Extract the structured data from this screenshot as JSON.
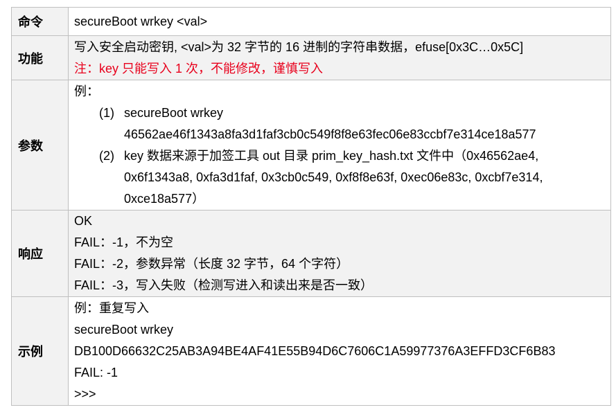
{
  "rows": {
    "command": {
      "label": "命令",
      "text": "secureBoot wrkey <val>"
    },
    "function": {
      "label": "功能",
      "line1": "写入安全启动密钥, <val>为 32 字节的 16 进制的字符串数据，efuse[0x3C…0x5C]",
      "line2": "注：key 只能写入 1 次，不能修改，谨慎写入"
    },
    "params": {
      "label": "参数",
      "intro": "例：",
      "item1_num": "(1)",
      "item1_cmd": "secureBoot wrkey",
      "item1_val": "46562ae46f1343a8fa3d1faf3cb0c549f8f8e63fec06e83ccbf7e314ce18a577",
      "item2_num": "(2)",
      "item2_line1": "key 数据来源于加签工具 out 目录 prim_key_hash.txt 文件中（0x46562ae4,",
      "item2_line2": "0x6f1343a8, 0xfa3d1faf, 0x3cb0c549, 0xf8f8e63f, 0xec06e83c, 0xcbf7e314,",
      "item2_line3": "0xce18a577）"
    },
    "response": {
      "label": "响应",
      "line1": "OK",
      "line2": "FAIL：-1，不为空",
      "line3": "FAIL：-2，参数异常（长度 32 字节，64 个字符）",
      "line4": "FAIL：-3，写入失败（检测写进入和读出来是否一致）"
    },
    "example": {
      "label": "示例",
      "line1": "例：重复写入",
      "line2": "secureBoot wrkey",
      "line3": "DB100D66632C25AB3A94BE4AF41E55B94D6C7606C1A59977376A3EFFD3CF6B83",
      "line4": "FAIL: -1",
      "line5": ">>>"
    }
  }
}
